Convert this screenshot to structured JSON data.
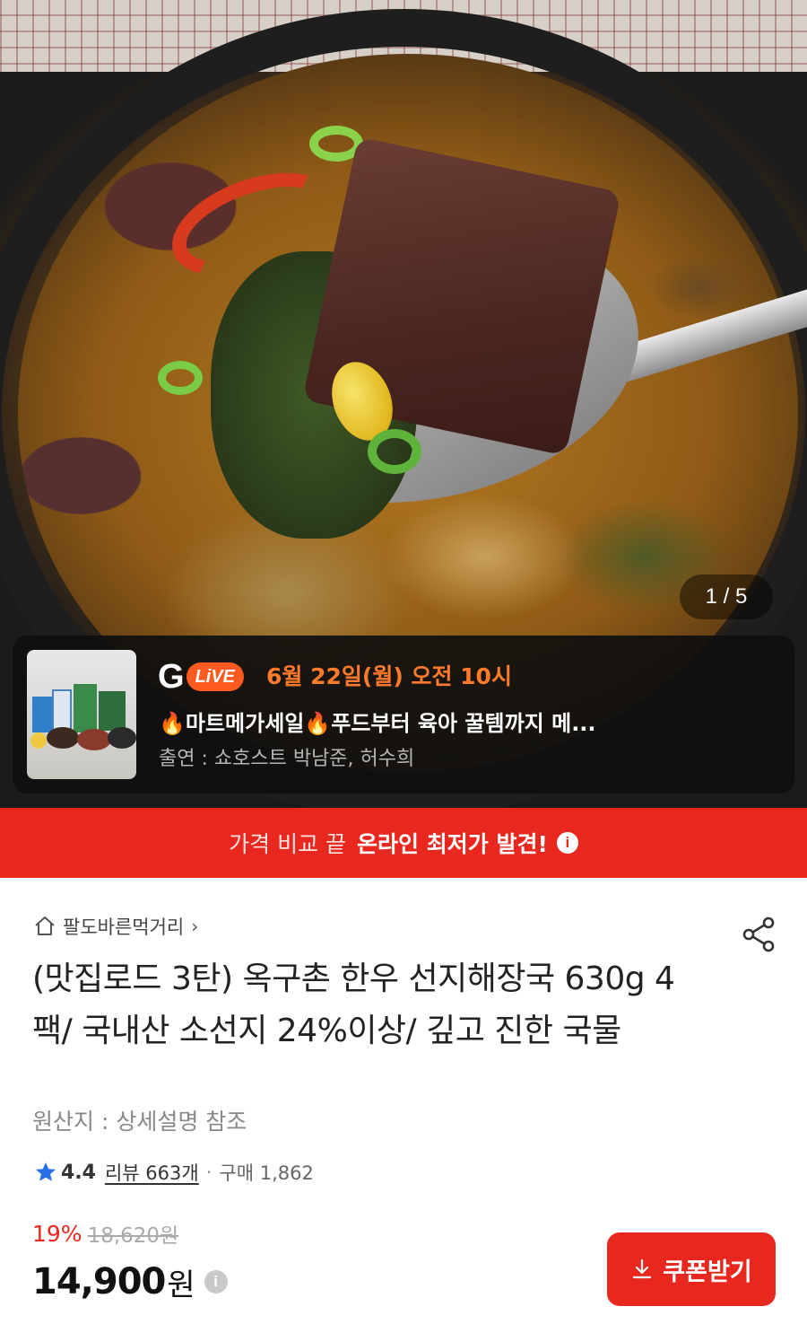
{
  "hero": {
    "image_counter": "1 / 5"
  },
  "live_banner": {
    "logo_letter": "G",
    "logo_badge": "LiVE",
    "date": "6월 22일(월) 오전 10시",
    "title": "🔥마트메가세일🔥푸드부터 육아 꿀템까지 메...",
    "host": "출연 : 쇼호스트 박남준, 허수희"
  },
  "price_banner": {
    "lead": "가격 비교 끝",
    "highlight": "온라인 최저가 발견!",
    "info_icon": "i"
  },
  "product": {
    "store_name": "팔도바른먹거리",
    "store_chevron": "›",
    "title": "(맛집로드 3탄) 옥구촌 한우 선지해장국 630g 4팩/ 국내산 소선지 24%이상/ 깊고 진한 국물",
    "origin": "원산지 : 상세설명 참조",
    "rating": "4.4",
    "reviews": "리뷰 663개",
    "separator": "·",
    "purchases": "구매 1,862",
    "discount_percent": "19%",
    "original_price": "18,620원",
    "sale_price": "14,900",
    "currency_unit": "원",
    "price_info_icon": "i",
    "coupon_button": "쿠폰받기"
  },
  "colors": {
    "accent_red": "#e8281e",
    "live_orange": "#ff7a2a",
    "star_blue": "#2a6fe8"
  },
  "icons": [
    "home-icon",
    "share-icon",
    "star-icon",
    "info-icon",
    "download-icon"
  ]
}
